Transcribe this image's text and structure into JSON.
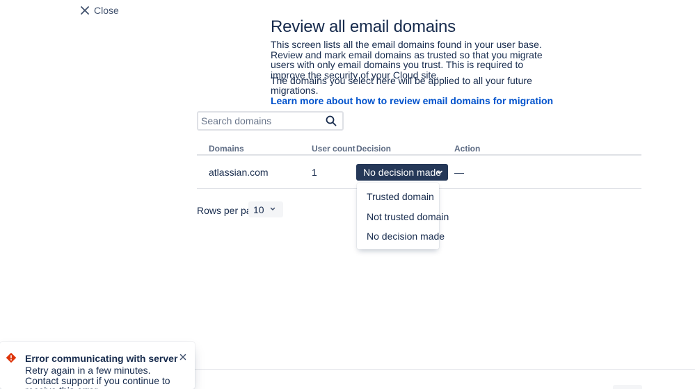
{
  "header": {
    "close_label": "Close"
  },
  "page": {
    "title": "Review all email domains",
    "description": "This screen lists all the email domains found in your user base. Review and mark email domains as trusted so that you migrate users with only email domains you trust. This is required to improve the security of your Cloud site.",
    "note": "The domains you select here will be applied to all your future migrations.",
    "learn_more_link": "Learn more about how to review email domains for migration"
  },
  "search": {
    "placeholder": "Search domains",
    "value": ""
  },
  "table": {
    "columns": [
      "Domains",
      "User count",
      "Decision",
      "Action"
    ],
    "rows": [
      {
        "domain": "atlassian.com",
        "user_count": "1",
        "decision": "No decision made",
        "action": "—"
      }
    ]
  },
  "decision_menu": {
    "options": [
      "Trusted domain",
      "Not trusted domain",
      "No decision made"
    ]
  },
  "pagination": {
    "rows_label": "Rows per page",
    "rows_value": "10"
  },
  "error_flag": {
    "title": "Error communicating with server",
    "body": "Retry again in a few minutes. Contact support if you continue to receive this error.",
    "icon": "error-icon",
    "color": "#de350b"
  },
  "colors": {
    "primary_dark": "#253858",
    "link": "#0052cc",
    "text": "#172b4d",
    "error": "#de350b"
  }
}
